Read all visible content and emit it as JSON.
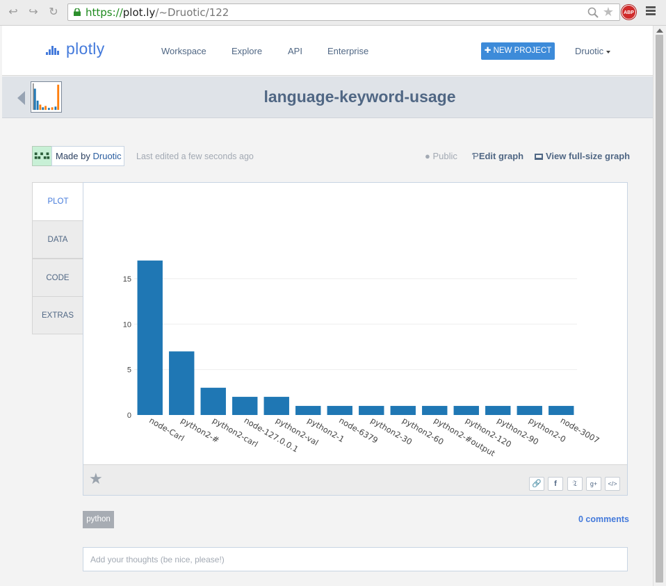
{
  "browser": {
    "url_scheme": "https://",
    "url_host": "plot.ly",
    "url_path": "/~Druotic/122",
    "adblock_label": "ABP"
  },
  "header": {
    "logo_text": "plotly",
    "nav": [
      "Workspace",
      "Explore",
      "API",
      "Enterprise"
    ],
    "new_project_label": "NEW PROJECT",
    "username": "Druotic"
  },
  "title_band": {
    "title": "language-keyword-usage"
  },
  "meta": {
    "made_by_prefix": "Made by",
    "author": "Druotic",
    "last_edited": "Last edited a few seconds ago",
    "public_label": "Public",
    "edit_label": "Edit graph",
    "full_size_label": "View full-size graph"
  },
  "tabs": [
    "PLOT",
    "DATA",
    "CODE",
    "EXTRAS"
  ],
  "tag": "python",
  "comments_label": "0 comments",
  "comment_placeholder": "Add your thoughts (be nice, please!)",
  "colors": {
    "bar": "#1f77b4",
    "accent": "#447adb",
    "title": "#506784"
  },
  "chart_data": {
    "type": "bar",
    "categories": [
      "node-Carl",
      "python2-#",
      "python2-carl",
      "node-127.0.0.1",
      "python2-val",
      "python2-1",
      "node-6379",
      "python2-30",
      "python2-60",
      "python2-#output",
      "python2-120",
      "python2-90",
      "python2-0",
      "node-3007"
    ],
    "values": [
      17,
      7,
      3,
      2,
      2,
      1,
      1,
      1,
      1,
      1,
      1,
      1,
      1,
      1
    ],
    "yticks": [
      0,
      5,
      10,
      15
    ],
    "ylim": [
      0,
      17.9
    ],
    "grid": true
  }
}
